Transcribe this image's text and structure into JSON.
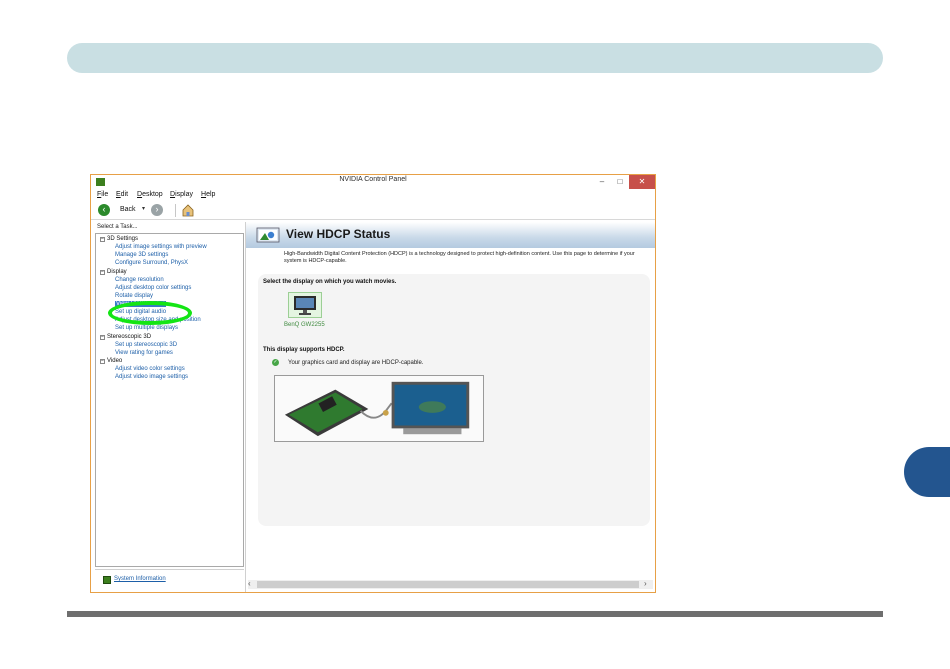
{
  "window": {
    "title": "NVIDIA Control Panel",
    "minimize": "–",
    "maximize": "□",
    "close": "✕"
  },
  "menu": [
    "File",
    "Edit",
    "Desktop",
    "Display",
    "Help"
  ],
  "toolbar": {
    "back_label": "Back",
    "back_icon": "‹",
    "forward_icon": "›",
    "dropdown_icon": "▾"
  },
  "sidebar": {
    "title": "Select a Task...",
    "categories": [
      {
        "label": "3D Settings",
        "items": [
          "Adjust image settings with preview",
          "Manage 3D settings",
          "Configure Surround, PhysX"
        ]
      },
      {
        "label": "Display",
        "items": [
          "Change resolution",
          "Adjust desktop color settings",
          "Rotate display",
          "View HDCP status",
          "Set up digital audio",
          "Adjust desktop size and position",
          "Set up multiple displays"
        ]
      },
      {
        "label": "Stereoscopic 3D",
        "items": [
          "Set up stereoscopic 3D",
          "View rating for games"
        ]
      },
      {
        "label": "Video",
        "items": [
          "Adjust video color settings",
          "Adjust video image settings"
        ]
      }
    ],
    "selected": "View HDCP status",
    "collapse_glyph": "−",
    "system_info_link": "System Information"
  },
  "content": {
    "title": "View HDCP Status",
    "description": "High-Bandwidth Digital Content Protection (HDCP) is a technology designed to protect high-definition content. Use this page to determine if your system is HDCP-capable.",
    "select_display_label": "Select the display on which you watch movies.",
    "monitor_name": "BenQ GW2255",
    "supports_label": "This display supports HDCP.",
    "status_text": "Your graphics card and display are HDCP-capable.",
    "status_icon": "✓"
  },
  "scrollbar": {
    "left": "‹",
    "right": "›"
  },
  "colors": {
    "header_bar": "#c9dfe3",
    "chapter_tab": "#23558f",
    "highlight_ring": "#14e514",
    "link": "#1d5fa8",
    "selected_item": "#3b78c9",
    "nvidia_green": "#3c7f1e"
  }
}
